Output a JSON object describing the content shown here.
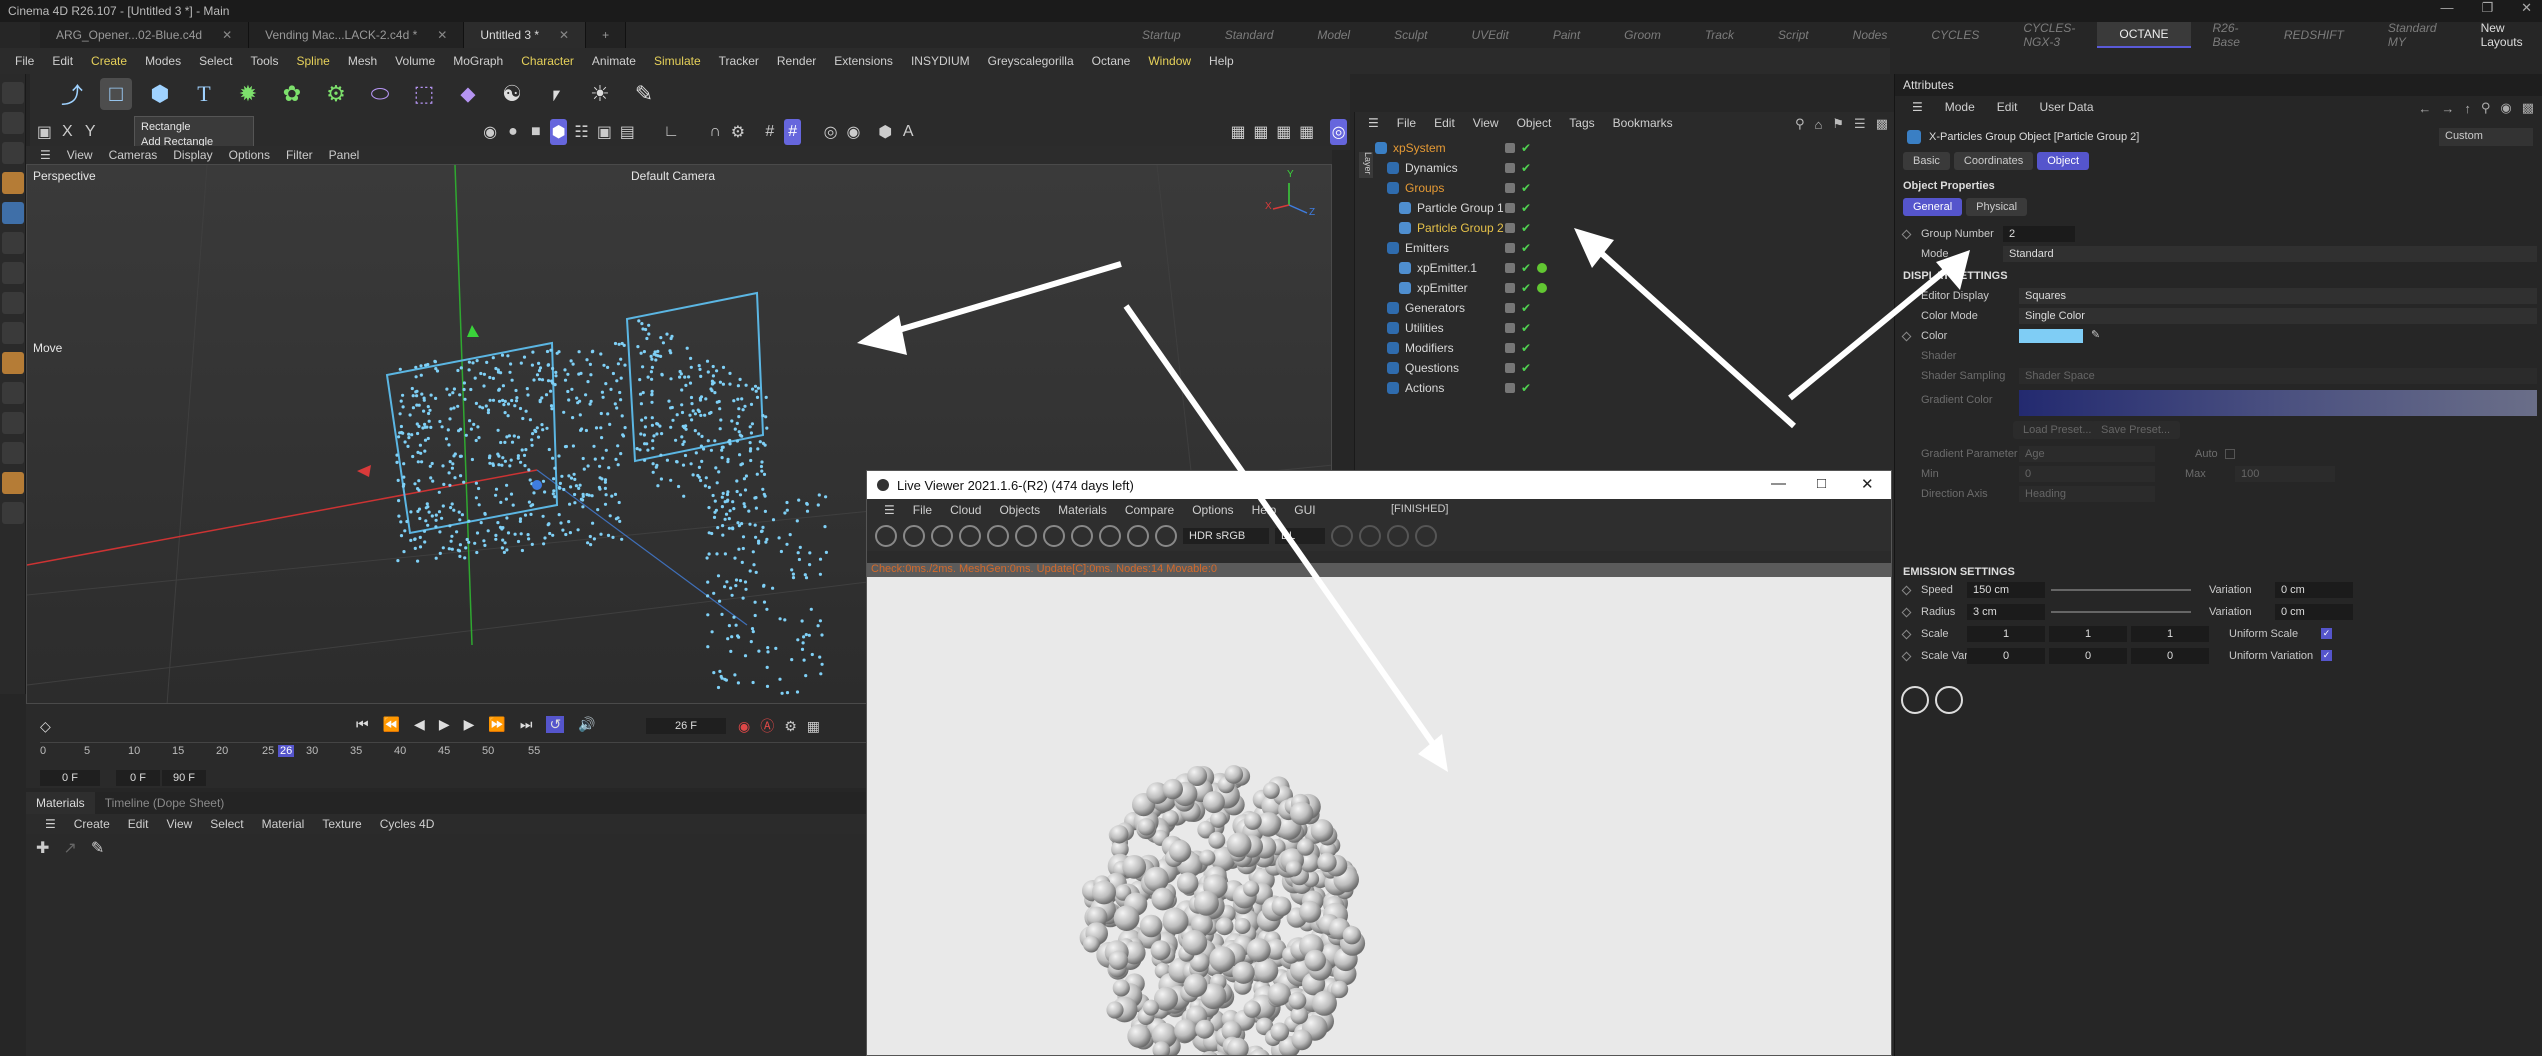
{
  "window": {
    "title": "Cinema 4D R26.107 - [Untitled 3 *] - Main",
    "tabs": [
      {
        "label": "ARG_Opener...02-Blue.c4d"
      },
      {
        "label": "Vending Mac...LACK-2.c4d *"
      },
      {
        "label": "Untitled 3 *"
      }
    ],
    "new_tab": "+",
    "layouts": [
      "Startup",
      "Standard",
      "Model",
      "Sculpt",
      "UVEdit",
      "Paint",
      "Groom",
      "Track",
      "Script",
      "Nodes",
      "CYCLES",
      "CYCLES-NGX-3",
      "OCTANE",
      "R26-Base",
      "REDSHIFT",
      "Standard MY"
    ],
    "active_layout": "OCTANE",
    "new_layouts": "New Layouts"
  },
  "menubar": [
    "File",
    "Edit",
    "Create",
    "Modes",
    "Select",
    "Tools",
    "Spline",
    "Mesh",
    "Volume",
    "MoGraph",
    "Character",
    "Animate",
    "Simulate",
    "Tracker",
    "Render",
    "Extensions",
    "INSYDIUM",
    "Greyscalegorilla",
    "Octane",
    "Window",
    "Help"
  ],
  "tooltip": {
    "title": "Rectangle",
    "desc": "Add Rectangle Object"
  },
  "coord_labels": {
    "x": "X",
    "y": "Y"
  },
  "viewport": {
    "menu": [
      "View",
      "Cameras",
      "Display",
      "Options",
      "Filter",
      "Panel"
    ],
    "projection": "Perspective",
    "camera": "Default Camera",
    "tool": "Move",
    "axis": {
      "x": "X",
      "y": "Y",
      "z": "Z"
    }
  },
  "timeline": {
    "current_frame": "26 F",
    "ticks": [
      "0",
      "5",
      "10",
      "15",
      "20",
      "25",
      "26",
      "30",
      "35",
      "40",
      "45",
      "50",
      "55"
    ],
    "start": "0 F",
    "range_start": "0 F",
    "range_end": "90 F"
  },
  "materials": {
    "tabs": [
      "Materials",
      "Timeline (Dope Sheet)"
    ],
    "menu": [
      "Create",
      "Edit",
      "View",
      "Select",
      "Material",
      "Texture",
      "Cycles 4D"
    ]
  },
  "object_manager": {
    "menu": [
      "File",
      "Edit",
      "View",
      "Object",
      "Tags",
      "Bookmarks"
    ],
    "objects": [
      {
        "name": "xpSystem",
        "indent": 0,
        "color": "#e59a35"
      },
      {
        "name": "Dynamics",
        "indent": 1,
        "color": "#d9d9d9"
      },
      {
        "name": "Groups",
        "indent": 1,
        "color": "#e59a35"
      },
      {
        "name": "Particle Group 1",
        "indent": 2,
        "color": "#d9d9d9"
      },
      {
        "name": "Particle Group 2",
        "indent": 2,
        "color": "#e6c24a"
      },
      {
        "name": "Emitters",
        "indent": 1,
        "color": "#d9d9d9"
      },
      {
        "name": "xpEmitter.1",
        "indent": 2,
        "color": "#d9d9d9"
      },
      {
        "name": "xpEmitter",
        "indent": 2,
        "color": "#d9d9d9"
      },
      {
        "name": "Generators",
        "indent": 1,
        "color": "#d9d9d9"
      },
      {
        "name": "Utilities",
        "indent": 1,
        "color": "#d9d9d9"
      },
      {
        "name": "Modifiers",
        "indent": 1,
        "color": "#d9d9d9"
      },
      {
        "name": "Questions",
        "indent": 1,
        "color": "#d9d9d9"
      },
      {
        "name": "Actions",
        "indent": 1,
        "color": "#d9d9d9"
      }
    ],
    "side_tab": "Layer"
  },
  "attributes": {
    "panel_title": "Attributes",
    "menu": [
      "Mode",
      "Edit",
      "User Data"
    ],
    "object_title": "X-Particles Group Object [Particle Group 2]",
    "preset": "Custom",
    "tabs": [
      "Basic",
      "Coordinates",
      "Object"
    ],
    "active_tab": "Object",
    "section_object": "Object Properties",
    "subtabs": [
      "General",
      "Physical"
    ],
    "group_number_label": "Group Number",
    "group_number": "2",
    "mode_label": "Mode",
    "mode_value": "Standard",
    "display_section": "DISPLAY SETTINGS",
    "editor_display_label": "Editor Display",
    "editor_display": "Squares",
    "color_mode_label": "Color Mode",
    "color_mode": "Single Color",
    "color_label": "Color",
    "color_value": "#7fcdf5",
    "shader_label": "Shader",
    "shader_sampling_label": "Shader Sampling",
    "shader_sampling": "Shader Space",
    "gradient_color_label": "Gradient Color",
    "load_preset": "Load Preset...",
    "save_preset": "Save Preset...",
    "gradient_param_label": "Gradient Parameter",
    "gradient_param": "Age",
    "auto_label": "Auto",
    "min_label": "Min",
    "min_value": "0",
    "max_label": "Max",
    "max_value": "100",
    "direction_axis_label": "Direction Axis",
    "direction_axis": "Heading",
    "emission_section": "EMISSION SETTINGS",
    "speed_label": "Speed",
    "speed": "150 cm",
    "variation_label": "Variation",
    "speed_variation": "0 cm",
    "radius_label": "Radius",
    "radius": "3 cm",
    "radius_variation": "0 cm",
    "scale_label": "Scale",
    "scale": [
      "1",
      "1",
      "1"
    ],
    "uniform_scale_label": "Uniform Scale",
    "scale_var_label": "Scale Var.",
    "scale_var": [
      "0",
      "0",
      "0"
    ],
    "uniform_variation_label": "Uniform Variation"
  },
  "live_viewer": {
    "title": "Live Viewer 2021.1.6-(R2) (474 days left)",
    "menu": [
      "File",
      "Cloud",
      "Objects",
      "Materials",
      "Compare",
      "Options",
      "Help",
      "GUI"
    ],
    "state": "[FINISHED]",
    "color_space": "HDR sRGB",
    "kernel": "DL",
    "status": "Check:0ms./2ms. MeshGen:0ms. Update[C]:0ms. Nodes:14 Movable:0"
  },
  "colors": {
    "accent": "#5555cc",
    "particles": "#7fd0f6",
    "arrow": "#ffffff"
  }
}
